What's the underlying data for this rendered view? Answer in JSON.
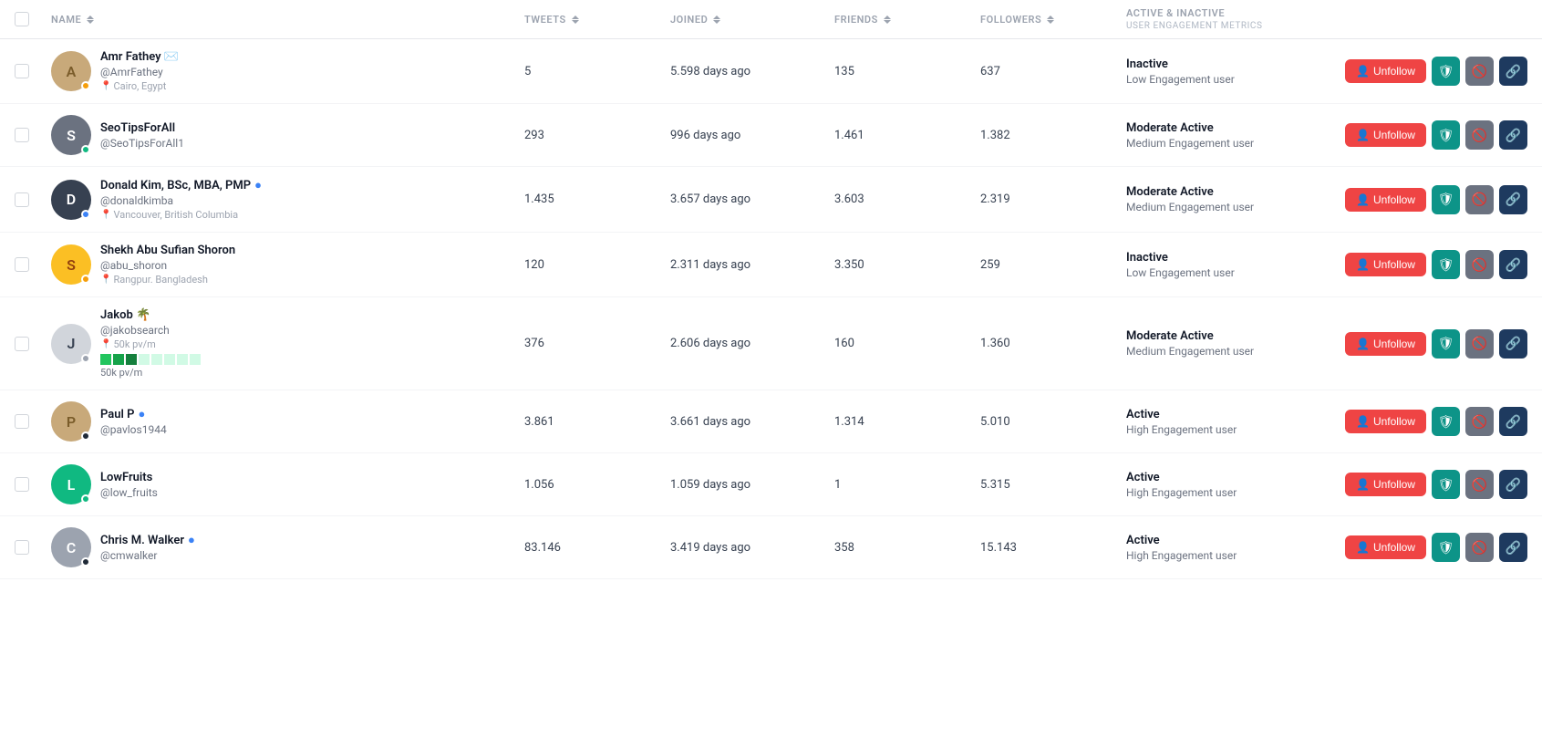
{
  "header": {
    "checkbox_label": "select-all",
    "columns": [
      {
        "id": "name",
        "label": "NAME",
        "sortable": true
      },
      {
        "id": "tweets",
        "label": "TWEETS",
        "sortable": true
      },
      {
        "id": "joined",
        "label": "JOINED",
        "sortable": true
      },
      {
        "id": "friends",
        "label": "FRIENDS",
        "sortable": true
      },
      {
        "id": "followers",
        "label": "FOLLOWERS",
        "sortable": true
      },
      {
        "id": "engagement",
        "label": "ACTIVE & INACTIVE",
        "sublabel": "User Engagement Metrics",
        "sortable": false
      }
    ]
  },
  "rows": [
    {
      "id": 1,
      "name": "Amr Fathey ✉️",
      "handle": "@AmrFathey",
      "location": "Cairo, Egypt",
      "verified": false,
      "avatar_color": "#c8a97a",
      "avatar_letter": "A",
      "dot_color": "yellow",
      "tweets": "5",
      "joined": "5.598 days ago",
      "friends": "135",
      "followers": "637",
      "engagement_status": "Inactive",
      "engagement_label": "Low Engagement user"
    },
    {
      "id": 2,
      "name": "SeoTipsForAll",
      "handle": "@SeoTipsForAll1",
      "location": "",
      "verified": false,
      "avatar_color": "#6b7280",
      "avatar_letter": "S",
      "dot_color": "green",
      "tweets": "293",
      "joined": "996 days ago",
      "friends": "1.461",
      "followers": "1.382",
      "engagement_status": "Moderate Active",
      "engagement_label": "Medium Engagement user"
    },
    {
      "id": 3,
      "name": "Donald Kim, BSc, MBA, PMP",
      "handle": "@donaldkimba",
      "location": "Vancouver, British Columbia",
      "verified": true,
      "avatar_color": "#9ca3af",
      "avatar_letter": "D",
      "dot_color": "blue",
      "tweets": "1.435",
      "joined": "3.657 days ago",
      "friends": "3.603",
      "followers": "2.319",
      "engagement_status": "Moderate Active",
      "engagement_label": "Medium Engagement user"
    },
    {
      "id": 4,
      "name": "Shekh Abu Sufian Shoron",
      "handle": "@abu_shoron",
      "location": "Rangpur. Bangladesh",
      "verified": false,
      "avatar_color": "#f59e0b",
      "avatar_letter": "S",
      "dot_color": "yellow",
      "tweets": "120",
      "joined": "2.311 days ago",
      "friends": "3.350",
      "followers": "259",
      "engagement_status": "Inactive",
      "engagement_label": "Low Engagement user"
    },
    {
      "id": 5,
      "name": "Jakob 🌴",
      "handle": "@jakobsearch",
      "location": "50k pv/m",
      "verified": false,
      "avatar_color": "#d1d5db",
      "avatar_letter": "J",
      "dot_color": "gray",
      "tweets": "376",
      "joined": "2.606 days ago",
      "friends": "160",
      "followers": "1.360",
      "engagement_status": "Moderate Active",
      "engagement_label": "Medium Engagement user",
      "has_tags": true
    },
    {
      "id": 6,
      "name": "Paul P",
      "handle": "@pavlos1944",
      "location": "",
      "verified": true,
      "avatar_color": "#c8a97a",
      "avatar_letter": "P",
      "dot_color": "dark",
      "tweets": "3.861",
      "joined": "3.661 days ago",
      "friends": "1.314",
      "followers": "5.010",
      "engagement_status": "Active",
      "engagement_label": "High Engagement user"
    },
    {
      "id": 7,
      "name": "LowFruits",
      "handle": "@low_fruits",
      "location": "",
      "verified": false,
      "avatar_color": "#10b981",
      "avatar_letter": "L",
      "dot_color": "green",
      "tweets": "1.056",
      "joined": "1.059 days ago",
      "friends": "1",
      "followers": "5.315",
      "engagement_status": "Active",
      "engagement_label": "High Engagement user"
    },
    {
      "id": 8,
      "name": "Chris M. Walker",
      "handle": "@cmwalker",
      "location": "",
      "verified": true,
      "avatar_color": "#9ca3af",
      "avatar_letter": "C",
      "dot_color": "dark",
      "tweets": "83.146",
      "joined": "3.419 days ago",
      "friends": "358",
      "followers": "15.143",
      "engagement_status": "Active",
      "engagement_label": "High Engagement user"
    }
  ],
  "buttons": {
    "unfollow": "Unfollow"
  }
}
